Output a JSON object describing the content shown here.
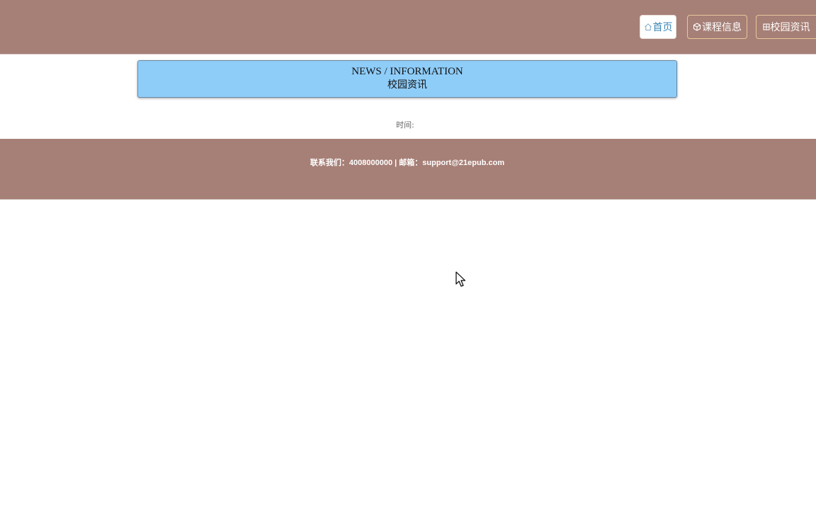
{
  "nav": {
    "home_label": "首页",
    "course_label": "课程信息",
    "news_label": "校园资讯",
    "home_icon": "home-icon",
    "course_icon": "box-icon",
    "news_icon": "grid-icon"
  },
  "banner": {
    "title_en": "NEWS / INFORMATION",
    "title_cn": "校园资讯"
  },
  "article": {
    "time_label": "时间:"
  },
  "footer": {
    "contact_text": "联系我们：4008000000 | 邮箱：support@21epub.com"
  },
  "colors": {
    "header_bg": "#a67f76",
    "banner_bg": "#8fcdf9",
    "home_text": "#3b86b5",
    "nav_border": "#e9c79a"
  }
}
